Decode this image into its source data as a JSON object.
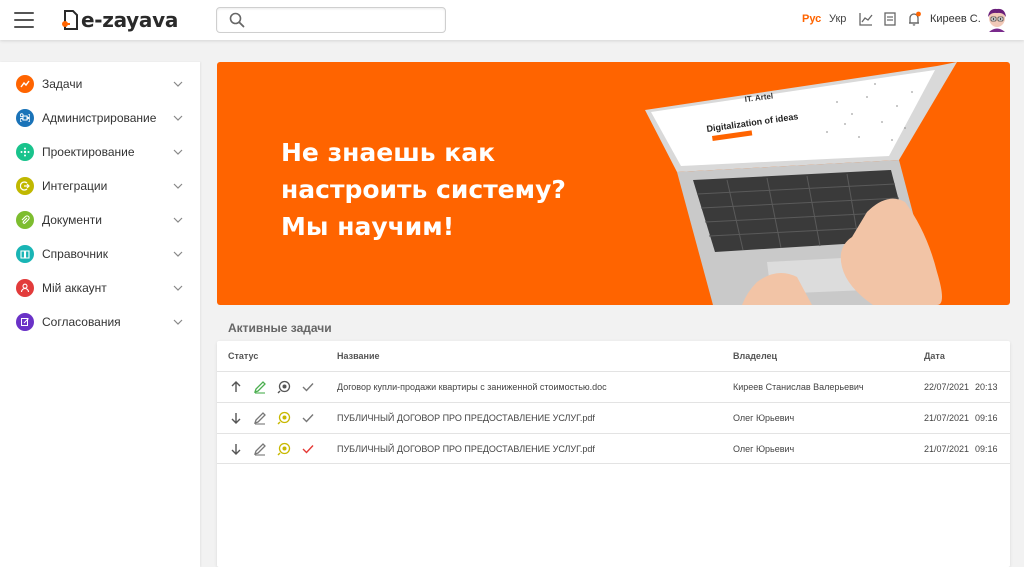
{
  "app": {
    "logo_text": "e-zayava"
  },
  "header": {
    "search_placeholder": "",
    "languages": [
      "Рус",
      "Укр"
    ],
    "active_language": "Рус",
    "user_name": "Киреев С.",
    "icons": [
      "stats-icon",
      "document-icon",
      "bell-icon"
    ],
    "notification_dot_color": "#ff6400"
  },
  "sidebar": {
    "items": [
      {
        "label": "Задачи",
        "icon": "tasks-icon",
        "color": "#ff6400"
      },
      {
        "label": "Администрирование",
        "icon": "command-icon",
        "color": "#1a73b8"
      },
      {
        "label": "Проектирование",
        "icon": "design-icon",
        "color": "#19c38c"
      },
      {
        "label": "Интеграции",
        "icon": "integration-icon",
        "color": "#c0b800"
      },
      {
        "label": "Документи",
        "icon": "attachment-icon",
        "color": "#7dbd2f"
      },
      {
        "label": "Справочник",
        "icon": "book-icon",
        "color": "#19b5b5"
      },
      {
        "label": "Мій аккаунт",
        "icon": "user-icon",
        "color": "#e23b3b"
      },
      {
        "label": "Согласования",
        "icon": "edit-document-icon",
        "color": "#6a32c7"
      }
    ]
  },
  "banner": {
    "lines": [
      "Не знаешь как",
      "настроить систему?",
      "Мы научим!"
    ],
    "background": "#ff6400",
    "laptop_screen_brand": "IT. Artel",
    "laptop_screen_headline": "Digitalization of ideas"
  },
  "tasks": {
    "section_title": "Активные задачи",
    "columns": {
      "status": "Статус",
      "title": "Название",
      "owner": "Владелец",
      "date": "Дата"
    },
    "rows": [
      {
        "direction": "up",
        "title": "Договор купли-продажи квартиры с заниженной стоимостью.doc",
        "owner": "Киреев Станислав Валерьевич",
        "date": "22/07/2021",
        "time": "20:13",
        "edit_color": "#4caf50",
        "review_color": "#555555",
        "check_color": "#777777"
      },
      {
        "direction": "down",
        "title": "ПУБЛИЧНЫЙ ДОГОВОР ПРО ПРЕДОСТАВЛЕНИЕ УСЛУГ.pdf",
        "owner": "Олег Юрьевич",
        "date": "21/07/2021",
        "time": "09:16",
        "edit_color": "#777777",
        "review_color": "#c8b800",
        "check_color": "#777777"
      },
      {
        "direction": "down",
        "title": "ПУБЛИЧНЫЙ ДОГОВОР ПРО ПРЕДОСТАВЛЕНИЕ УСЛУГ.pdf",
        "owner": "Олег Юрьевич",
        "date": "21/07/2021",
        "time": "09:16",
        "edit_color": "#777777",
        "review_color": "#c8b800",
        "check_color": "#e53935"
      }
    ]
  }
}
